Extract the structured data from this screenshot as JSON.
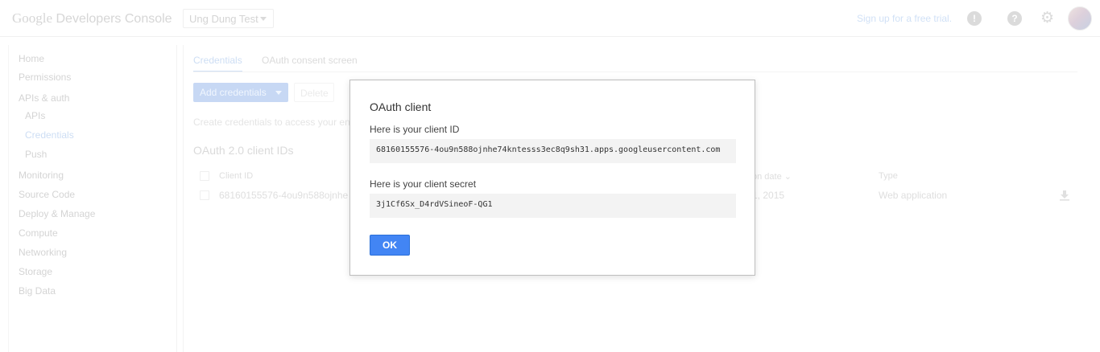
{
  "header": {
    "logo_google": "Google",
    "logo_product": "Developers Console",
    "project_name": "Ung Dung Test",
    "signup_text": "Sign up for a free trial.",
    "icons": [
      "feedback-icon",
      "help-icon",
      "gear-icon",
      "avatar"
    ]
  },
  "sidebar": {
    "items": [
      {
        "label": "Home"
      },
      {
        "label": "Permissions"
      },
      {
        "label": "APIs & auth"
      },
      {
        "label": "APIs"
      },
      {
        "label": "Credentials"
      },
      {
        "label": "Push"
      },
      {
        "label": "Monitoring"
      },
      {
        "label": "Source Code"
      },
      {
        "label": "Deploy & Manage"
      },
      {
        "label": "Compute"
      },
      {
        "label": "Networking"
      },
      {
        "label": "Storage"
      },
      {
        "label": "Big Data"
      }
    ]
  },
  "main": {
    "tabs": [
      {
        "label": "Credentials"
      },
      {
        "label": "OAuth consent screen"
      }
    ],
    "add_credentials_label": "Add credentials",
    "delete_label": "Delete",
    "hint_text": "Create credentials to access your en",
    "section_title": "OAuth 2.0 client IDs",
    "table": {
      "headers": {
        "client_id": "Client ID",
        "creation_date": "on date",
        "type": "Type"
      },
      "row": {
        "client_id": "68160155576-4ou9n588ojnhe",
        "creation_date": "1, 2015",
        "type": "Web application"
      }
    }
  },
  "dialog": {
    "title": "OAuth client",
    "client_id_label": "Here is your client ID",
    "client_id_value": "68160155576-4ou9n588ojnhe74kntesss3ec8q9sh31.apps.googleusercontent.com",
    "client_secret_label": "Here is your client secret",
    "client_secret_value": "3j1Cf6Sx_D4rdVSineoF-QG1",
    "ok_label": "OK"
  },
  "colors": {
    "accent": "#4285f4",
    "dim_link": "#b3ccee"
  }
}
